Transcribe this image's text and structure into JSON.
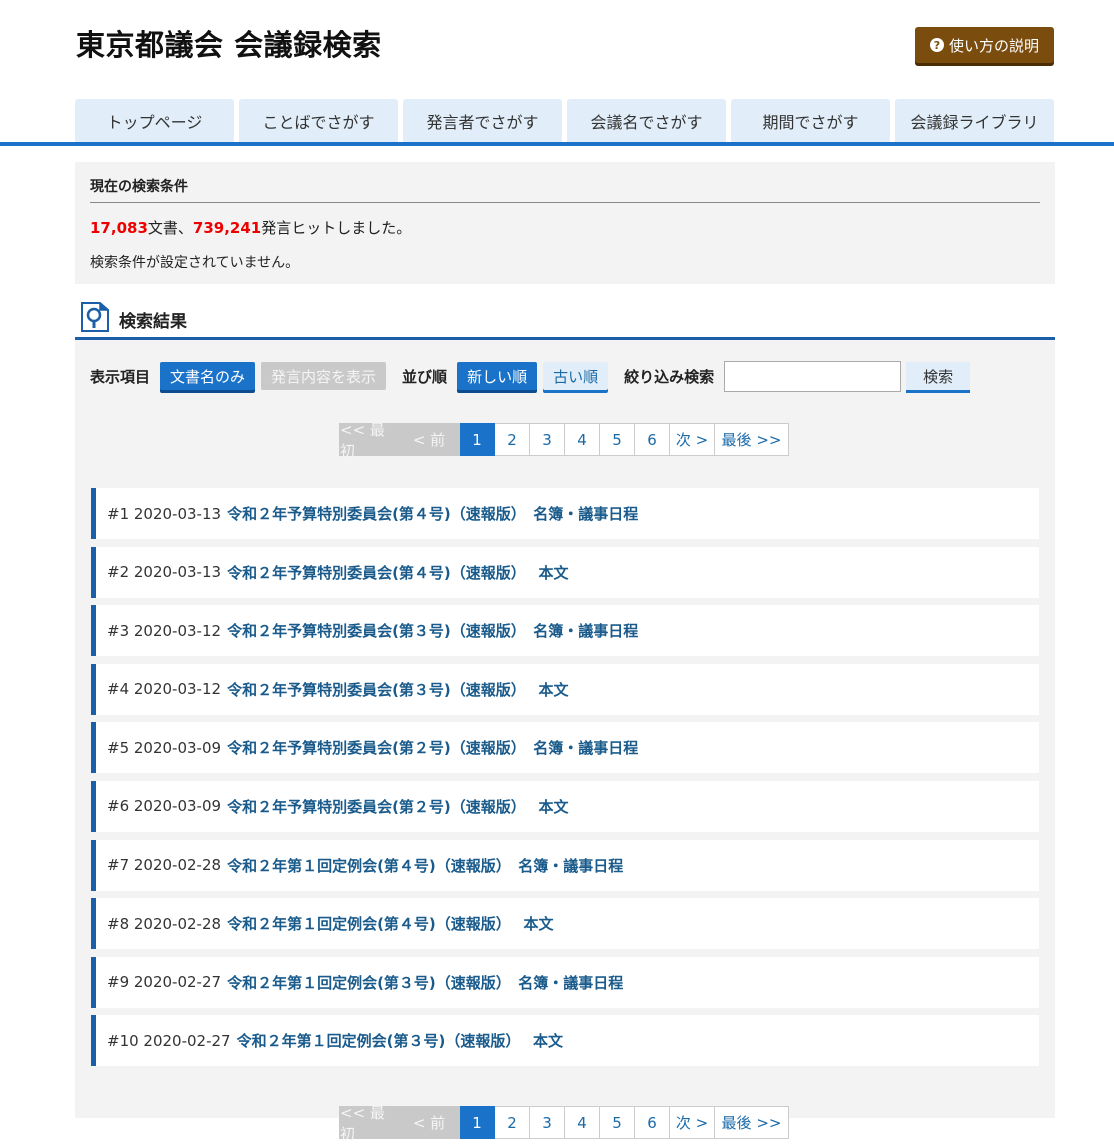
{
  "header": {
    "title": "東京都議会 会議録検索",
    "help_label": "使い方の説明"
  },
  "nav": {
    "tabs": [
      "トップページ",
      "ことばでさがす",
      "発言者でさがす",
      "会議名でさがす",
      "期間でさがす",
      "会議録ライブラリ"
    ]
  },
  "conditions": {
    "title": "現在の検索条件",
    "doc_count": "17,083",
    "doc_suffix": "文書、",
    "speech_count": "739,241",
    "speech_suffix": "発言ヒットしました。",
    "none_text": "検索条件が設定されていません。"
  },
  "results_heading": "検索結果",
  "toolbar": {
    "display_label": "表示項目",
    "doc_only": "文書名のみ",
    "show_content": "発言内容を表示",
    "order_label": "並び順",
    "newest": "新しい順",
    "oldest": "古い順",
    "filter_label": "絞り込み検索",
    "filter_value": "",
    "search_button": "検索"
  },
  "pager": {
    "first": "<< 最初",
    "prev": "< 前",
    "pages": [
      "1",
      "2",
      "3",
      "4",
      "5",
      "6"
    ],
    "next": "次 >",
    "last": "最後 >>"
  },
  "results": [
    {
      "meta": "#1 2020-03-13",
      "title": "令和２年予算特別委員会(第４号)（速報版）　名簿・議事日程"
    },
    {
      "meta": "#2 2020-03-13",
      "title": "令和２年予算特別委員会(第４号)（速報版）　 本文"
    },
    {
      "meta": "#3 2020-03-12",
      "title": "令和２年予算特別委員会(第３号)（速報版）　名簿・議事日程"
    },
    {
      "meta": "#4 2020-03-12",
      "title": "令和２年予算特別委員会(第３号)（速報版）　 本文"
    },
    {
      "meta": "#5 2020-03-09",
      "title": "令和２年予算特別委員会(第２号)（速報版）　名簿・議事日程"
    },
    {
      "meta": "#6 2020-03-09",
      "title": "令和２年予算特別委員会(第２号)（速報版）　 本文"
    },
    {
      "meta": "#7 2020-02-28",
      "title": "令和２年第１回定例会(第４号)（速報版）　名簿・議事日程"
    },
    {
      "meta": "#8 2020-02-28",
      "title": "令和２年第１回定例会(第４号)（速報版）　 本文"
    },
    {
      "meta": "#9 2020-02-27",
      "title": "令和２年第１回定例会(第３号)（速報版）　名簿・議事日程"
    },
    {
      "meta": "#10 2020-02-27",
      "title": "令和２年第１回定例会(第３号)（速報版）　 本文"
    }
  ]
}
